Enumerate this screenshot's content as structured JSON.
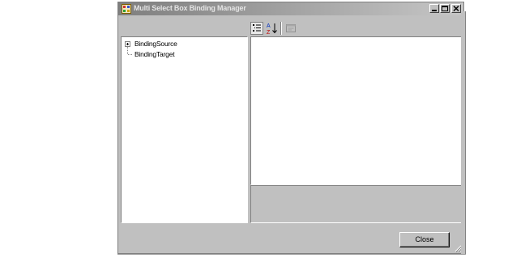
{
  "window": {
    "title": "Multi Select Box  Binding  Manager",
    "title_bar_gradient": [
      "#7f7f7f",
      "#c6c6c6"
    ],
    "face_color": "#c0c0c0"
  },
  "tree": {
    "items": [
      {
        "label": "BindingSource",
        "expandable": true,
        "icon": "plus-box-icon"
      },
      {
        "label": "BindingTarget",
        "expandable": false,
        "icon": "tree-line-icon"
      }
    ]
  },
  "toolbar": {
    "buttons": [
      {
        "name": "categorized",
        "icon": "categorized-view-icon"
      },
      {
        "name": "alphabetical",
        "icon": "alphabetical-sort-icon"
      },
      {
        "name": "property-pages",
        "icon": "property-pages-icon",
        "enabled": false
      }
    ]
  },
  "footer": {
    "close_label": "Close"
  }
}
